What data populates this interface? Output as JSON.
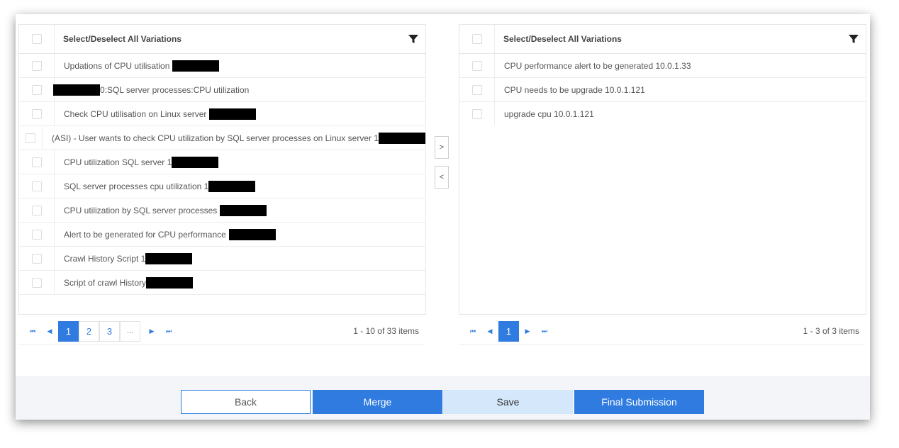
{
  "left_panel": {
    "header": "Select/Deselect All Variations",
    "rows": [
      {
        "text": "Updations of CPU utilisation"
      },
      {
        "text": "0:SQL server processes:CPU utilization"
      },
      {
        "text": "Check CPU utilisation on Linux server"
      },
      {
        "text": "(ASI) - User wants to check CPU utilization by SQL server processes on Linux server 1"
      },
      {
        "text": "CPU utilization SQL server 1"
      },
      {
        "text": "SQL server processes cpu utilization 1"
      },
      {
        "text": "CPU utilization by SQL server processes"
      },
      {
        "text": "Alert to be generated for CPU performance"
      },
      {
        "text": "Crawl History Script 1"
      },
      {
        "text": "Script of crawl History"
      }
    ],
    "pager": {
      "first_icon": "first-page-icon",
      "prev_icon": "prev-page-icon",
      "pages": [
        "1",
        "2",
        "3",
        "..."
      ],
      "next_icon": "next-page-icon",
      "last_icon": "last-page-icon",
      "info": "1 - 10 of 33 items"
    }
  },
  "right_panel": {
    "header": "Select/Deselect All Variations",
    "rows": [
      {
        "text": "CPU performance alert to be generated 10.0.1.33"
      },
      {
        "text": "CPU needs to be upgrade 10.0.1.121"
      },
      {
        "text": "upgrade cpu 10.0.1.121"
      }
    ],
    "pager": {
      "pages": [
        "1"
      ],
      "info": "1 - 3 of 3 items"
    }
  },
  "transfer": {
    "move_right": ">",
    "move_left": "<"
  },
  "footer": {
    "back": "Back",
    "merge": "Merge",
    "save": "Save",
    "final": "Final Submission"
  },
  "colors": {
    "accent": "#2f7be0",
    "save_bg": "#d5e8fb",
    "footer_bg": "#f3f5f8"
  }
}
